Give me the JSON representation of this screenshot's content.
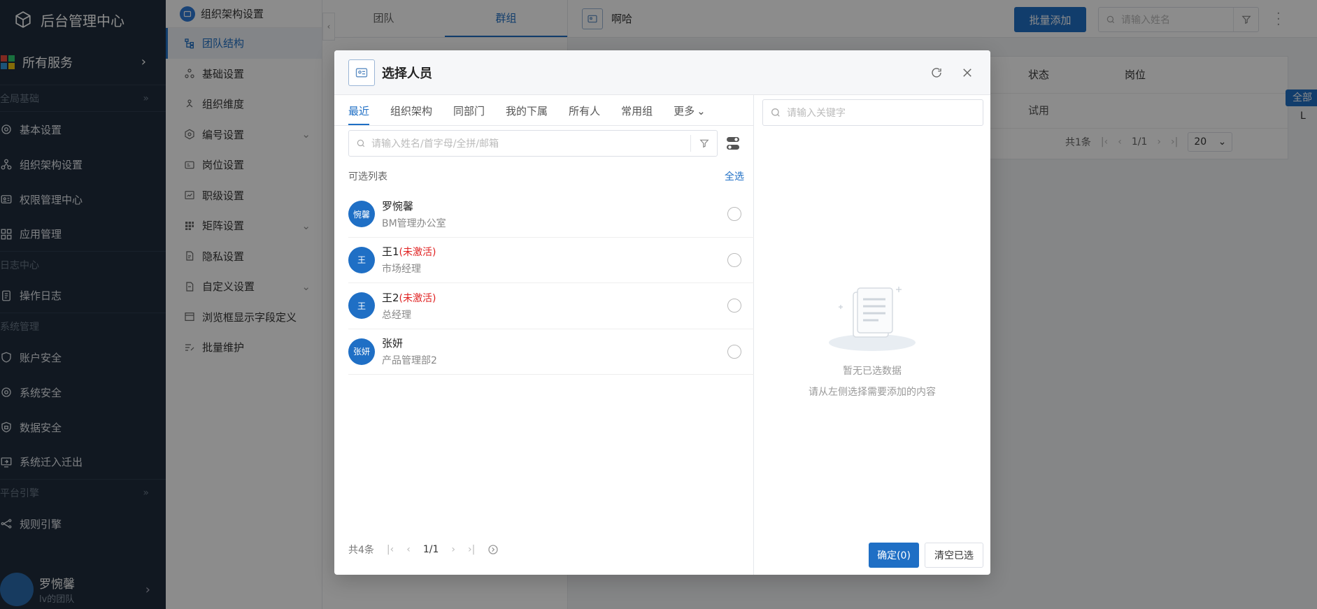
{
  "sidebar": {
    "title": "后台管理中心",
    "all_services": "所有服务",
    "groups": [
      {
        "label": "全局基础",
        "items": [
          "基本设置",
          "组织架构设置",
          "权限管理中心",
          "应用管理"
        ]
      },
      {
        "label": "日志中心",
        "items": [
          "操作日志"
        ]
      },
      {
        "label": "系统管理",
        "items": [
          "账户安全",
          "系统安全",
          "数据安全",
          "系统迁入迁出"
        ]
      },
      {
        "label": "平台引擎",
        "items": [
          "规则引擎"
        ]
      }
    ],
    "user": {
      "name": "罗惋馨",
      "sub": "lv的团队"
    }
  },
  "menu2": {
    "header": "组织架构设置",
    "items": [
      "团队结构",
      "基础设置",
      "组织维度",
      "编号设置",
      "岗位设置",
      "职级设置",
      "矩阵设置",
      "隐私设置",
      "自定义设置",
      "浏览框显示字段定义",
      "批量维护"
    ]
  },
  "col3": {
    "tabs": [
      "团队",
      "群组"
    ]
  },
  "main": {
    "title": "啊哈",
    "batch_add": "批量添加",
    "search_placeholder": "请输入姓名",
    "columns": [
      "状态",
      "岗位"
    ],
    "row": {
      "status": "试用"
    },
    "pager": {
      "total": "共1条",
      "page": "1/1",
      "size": "20"
    },
    "all_tag": "全部",
    "l_char": "L"
  },
  "modal": {
    "title": "选择人员",
    "tabs": [
      "最近",
      "组织架构",
      "同部门",
      "我的下属",
      "所有人",
      "常用组",
      "更多"
    ],
    "search_placeholder": "请输入姓名/首字母/全拼/邮箱",
    "list_label": "可选列表",
    "select_all": "全选",
    "people": [
      {
        "avatar": "惋馨",
        "name": "罗惋馨",
        "inactive": "",
        "sub": "BM管理办公室"
      },
      {
        "avatar": "王",
        "name": "王1",
        "inactive": "(未激活)",
        "sub": "市场经理"
      },
      {
        "avatar": "王",
        "name": "王2",
        "inactive": "(未激活)",
        "sub": "总经理"
      },
      {
        "avatar": "张妍",
        "name": "张妍",
        "inactive": "",
        "sub": "产品管理部2"
      }
    ],
    "pager": {
      "total": "共4条",
      "page": "1/1"
    },
    "right_search_placeholder": "请输入关键字",
    "empty_title": "暂无已选数据",
    "empty_sub": "请从左侧选择需要添加的内容",
    "confirm": "确定(0)",
    "clear": "清空已选"
  },
  "colors": {
    "primary": "#1f6fc5",
    "sidebar_bg": "#1f2d3d",
    "danger": "#e02020"
  }
}
